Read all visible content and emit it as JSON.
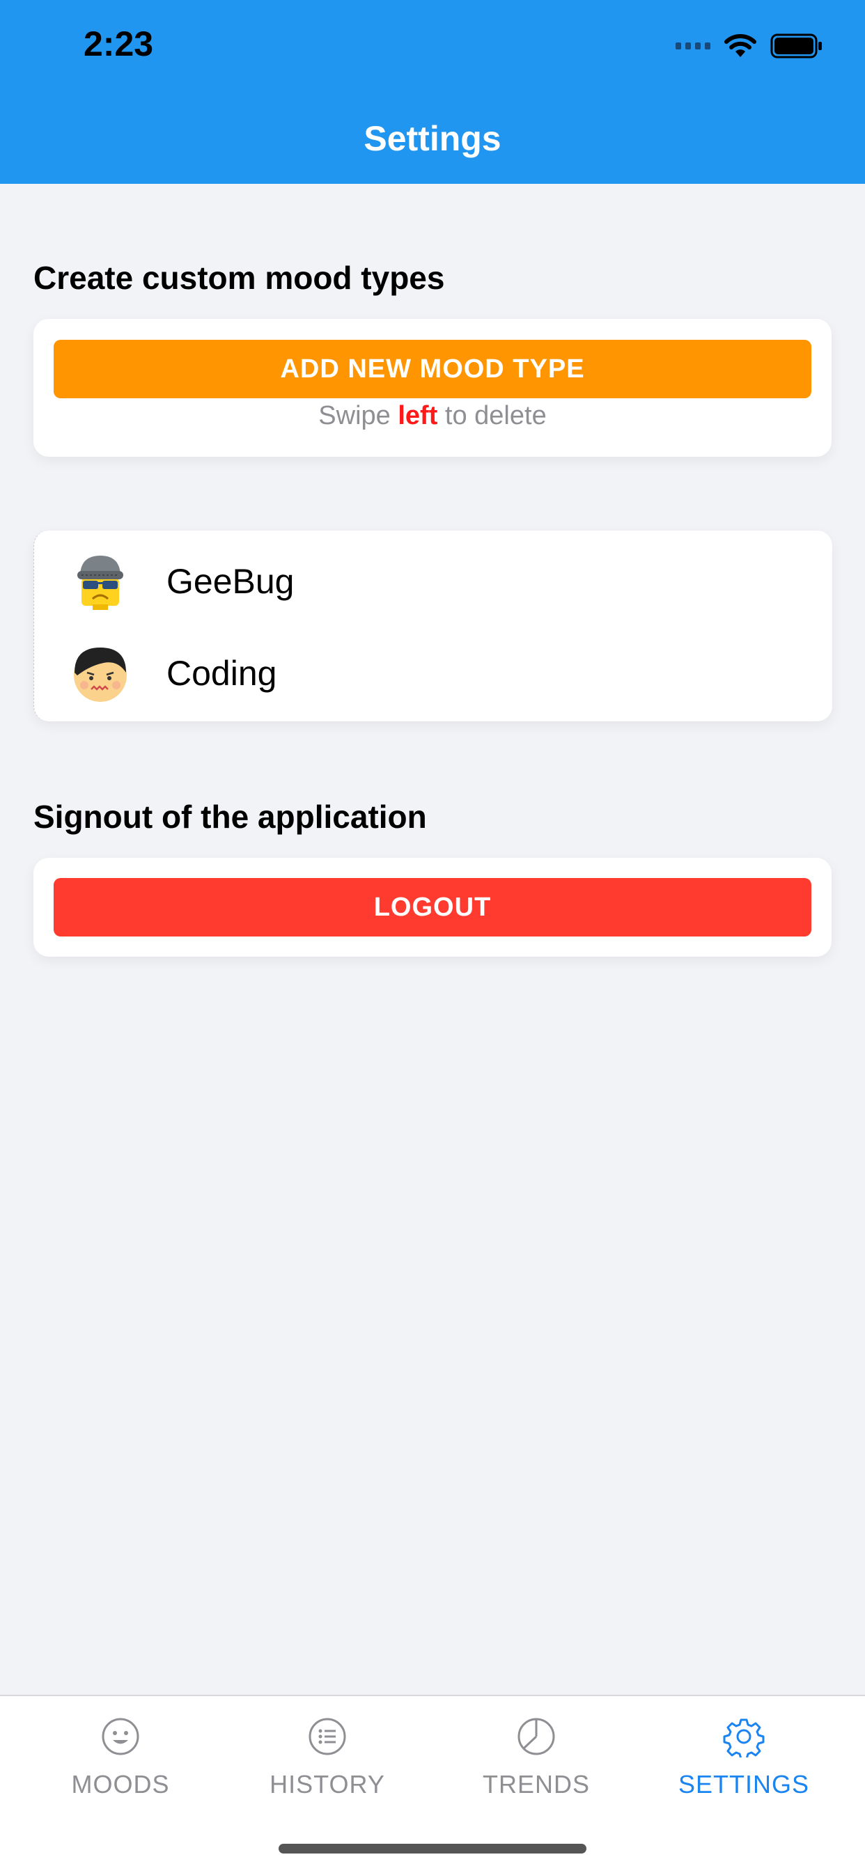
{
  "status_bar": {
    "time": "2:23"
  },
  "header": {
    "title": "Settings"
  },
  "custom_moods": {
    "section_title": "Create custom mood types",
    "add_button_label": "ADD NEW MOOD TYPE",
    "hint_prefix": "Swipe ",
    "hint_emphasis": "left",
    "hint_suffix": " to delete",
    "items": [
      {
        "label": "GeeBug",
        "icon": "robber-emoji-icon"
      },
      {
        "label": "Coding",
        "icon": "confused-face-icon"
      }
    ]
  },
  "signout": {
    "section_title": "Signout of the application",
    "logout_label": "LOGOUT"
  },
  "tabbar": {
    "tabs": [
      {
        "label": "MOODS",
        "icon": "smiley-icon",
        "active": false
      },
      {
        "label": "HISTORY",
        "icon": "list-icon",
        "active": false
      },
      {
        "label": "TRENDS",
        "icon": "pie-chart-icon",
        "active": false
      },
      {
        "label": "SETTINGS",
        "icon": "gear-icon",
        "active": true
      }
    ]
  },
  "colors": {
    "header": "#2196f0",
    "add_button": "#ff9500",
    "logout_button": "#ff3b30",
    "active_tab": "#1a84f0",
    "inactive_tab": "#8e8e93"
  }
}
